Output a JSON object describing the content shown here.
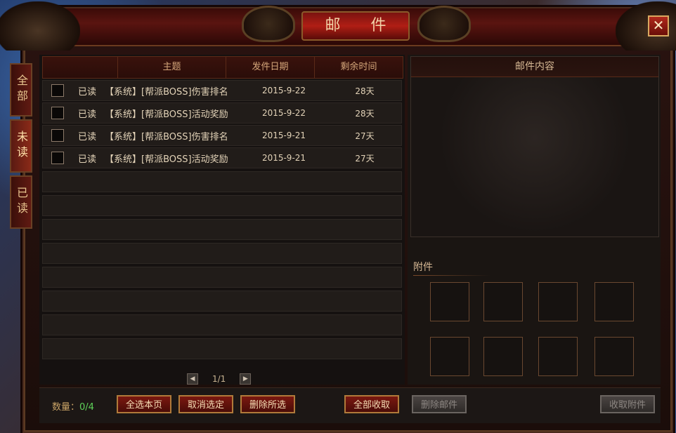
{
  "window": {
    "title": "邮 件"
  },
  "side_tabs": [
    {
      "label": "全部"
    },
    {
      "label": "未读"
    },
    {
      "label": "已读"
    }
  ],
  "table": {
    "headers": [
      "主题",
      "发件日期",
      "剩余时间"
    ],
    "rows": [
      {
        "status": "已读",
        "subject": "【系统】[帮派BOSS]伤害排名",
        "date": "2015-9-22",
        "remaining": "28天"
      },
      {
        "status": "已读",
        "subject": "【系统】[帮派BOSS]活动奖励",
        "date": "2015-9-22",
        "remaining": "28天"
      },
      {
        "status": "已读",
        "subject": "【系统】[帮派BOSS]伤害排名",
        "date": "2015-9-21",
        "remaining": "27天"
      },
      {
        "status": "已读",
        "subject": "【系统】[帮派BOSS]活动奖励",
        "date": "2015-9-21",
        "remaining": "27天"
      }
    ]
  },
  "pager": {
    "text": "1/1"
  },
  "content_panel": {
    "title": "邮件内容",
    "attachments_label": "附件"
  },
  "footer": {
    "count_label": "数量：",
    "count_value": "0/4",
    "select_all": "全选本页",
    "deselect": "取消选定",
    "delete_selected": "删除所选",
    "collect_all": "全部收取",
    "delete_mail": "删除邮件",
    "collect_attachments": "收取附件"
  },
  "close_icon": "close-icon"
}
